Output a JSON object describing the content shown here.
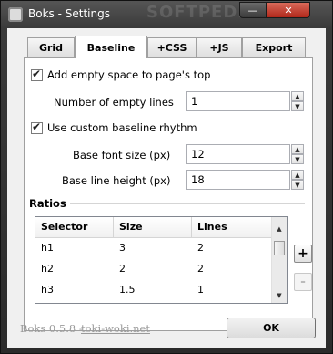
{
  "window": {
    "title": "Boks - Settings",
    "watermark": "SOFTPEDIA",
    "minimize_glyph": "—",
    "close_glyph": "✕"
  },
  "tabs": [
    {
      "label": "Grid",
      "active": false
    },
    {
      "label": "Baseline",
      "active": true
    },
    {
      "label": "+CSS",
      "active": false
    },
    {
      "label": "+JS",
      "active": false
    },
    {
      "label": "Export",
      "active": false
    }
  ],
  "baseline": {
    "add_space_label": "Add empty space to page's top",
    "add_space_checked": true,
    "empty_lines_label": "Number of empty lines",
    "empty_lines_value": "1",
    "custom_rhythm_label": "Use custom baseline rhythm",
    "custom_rhythm_checked": true,
    "font_size_label": "Base font size (px)",
    "font_size_value": "12",
    "line_height_label": "Base line height (px)",
    "line_height_value": "18"
  },
  "ratios": {
    "heading": "Ratios",
    "columns": [
      "Selector",
      "Size",
      "Lines"
    ],
    "rows": [
      {
        "selector": "h1",
        "size": "3",
        "lines": "2"
      },
      {
        "selector": "h2",
        "size": "2",
        "lines": "2"
      },
      {
        "selector": "h3",
        "size": "1.5",
        "lines": "1"
      }
    ],
    "add_label": "+",
    "remove_label": "-"
  },
  "footer": {
    "version": "Boks 0.5.8 - ",
    "link": "toki-woki.net",
    "ok_label": "OK"
  },
  "icons": {
    "spin_up": "▲",
    "spin_down": "▼",
    "check": "check-icon"
  }
}
